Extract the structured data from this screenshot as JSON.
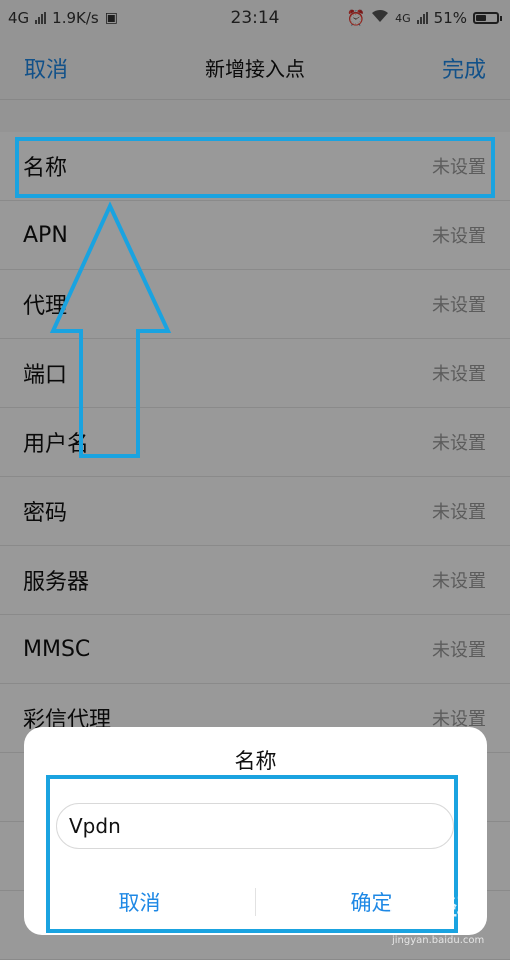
{
  "status_bar": {
    "network": "4G",
    "speed": "1.9K/s",
    "time": "23:14",
    "network_right": "4G",
    "battery": "51%",
    "battery_level": 0.51
  },
  "nav": {
    "cancel": "取消",
    "title": "新增接入点",
    "done": "完成"
  },
  "settings": [
    {
      "label": "名称",
      "value": "未设置"
    },
    {
      "label": "APN",
      "value": "未设置"
    },
    {
      "label": "代理",
      "value": "未设置"
    },
    {
      "label": "端口",
      "value": "未设置"
    },
    {
      "label": "用户名",
      "value": "未设置"
    },
    {
      "label": "密码",
      "value": "未设置"
    },
    {
      "label": "服务器",
      "value": "未设置"
    },
    {
      "label": "MMSC",
      "value": "未设置"
    },
    {
      "label": "彩信代理",
      "value": "未设置"
    },
    {
      "label": "",
      "value": ""
    },
    {
      "label": "",
      "value": ""
    },
    {
      "label": "",
      "value": ""
    }
  ],
  "dialog": {
    "title": "名称",
    "input_value": "Vpdn",
    "cancel": "取消",
    "confirm": "确定"
  },
  "watermark": {
    "text": "Bai 经验",
    "url": "jingyan.baidu.com"
  },
  "colors": {
    "accent": "#1e88e5",
    "annotation": "#1aa3e0"
  }
}
